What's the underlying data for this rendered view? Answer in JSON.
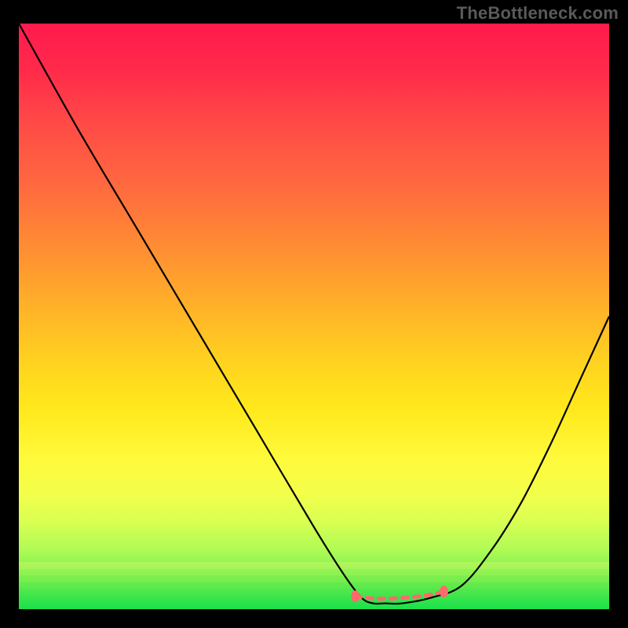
{
  "watermark": "TheBottleneck.com",
  "chart_data": {
    "type": "line",
    "title": "",
    "xlabel": "",
    "ylabel": "",
    "xlim": [
      0,
      100
    ],
    "ylim": [
      0,
      100
    ],
    "grid": false,
    "gradient_background": {
      "direction": "vertical",
      "stops": [
        {
          "pos": 0.0,
          "color": "#ff1a4d"
        },
        {
          "pos": 0.35,
          "color": "#ff8c33"
        },
        {
          "pos": 0.68,
          "color": "#ffe91c"
        },
        {
          "pos": 0.92,
          "color": "#8ff050"
        },
        {
          "pos": 1.0,
          "color": "#1de24b"
        }
      ]
    },
    "series": [
      {
        "name": "curve",
        "color": "#000000",
        "x": [
          0,
          10,
          20,
          30,
          40,
          50,
          55,
          58,
          60,
          62,
          65,
          70,
          75,
          80,
          85,
          90,
          95,
          100
        ],
        "y": [
          100,
          82,
          65,
          48,
          31,
          14,
          6,
          2,
          1,
          1,
          1,
          2,
          4,
          10,
          18,
          28,
          39,
          50
        ]
      },
      {
        "name": "flat-segment-markers",
        "color": "#ff6a6a",
        "type": "scatter",
        "x": [
          57,
          58.5,
          60,
          61.5,
          63,
          64.5,
          66,
          68,
          70,
          72
        ],
        "y": [
          2.2,
          2,
          1.8,
          1.8,
          1.8,
          1.9,
          2,
          2.2,
          2.5,
          3
        ]
      }
    ],
    "optimum_x_range": [
      58,
      72
    ],
    "annotations": []
  }
}
